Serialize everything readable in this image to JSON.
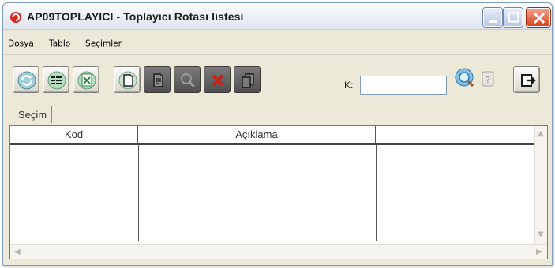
{
  "window": {
    "title": "AP09TOPLAYICI - Toplayıcı Rotası listesi"
  },
  "menubar": {
    "items": [
      "Dosya",
      "Tablo",
      "Seçimler"
    ]
  },
  "toolbar": {
    "search_label": "K:",
    "search_value": "",
    "buttons": [
      {
        "name": "refresh-icon",
        "enabled": true
      },
      {
        "name": "list-icon",
        "enabled": true
      },
      {
        "name": "excel-icon",
        "enabled": true
      },
      {
        "name": "new-document-icon",
        "enabled": true
      },
      {
        "name": "edit-document-icon",
        "enabled": false
      },
      {
        "name": "search-icon",
        "enabled": false
      },
      {
        "name": "delete-icon",
        "enabled": false
      },
      {
        "name": "copy-icon",
        "enabled": false
      }
    ]
  },
  "tabs": {
    "active": "Seçim"
  },
  "table": {
    "columns": [
      "Kod",
      "Açıklama",
      ""
    ],
    "rows": []
  },
  "colors": {
    "close_button": "#d7431f",
    "accent": "#2a8a3e"
  }
}
